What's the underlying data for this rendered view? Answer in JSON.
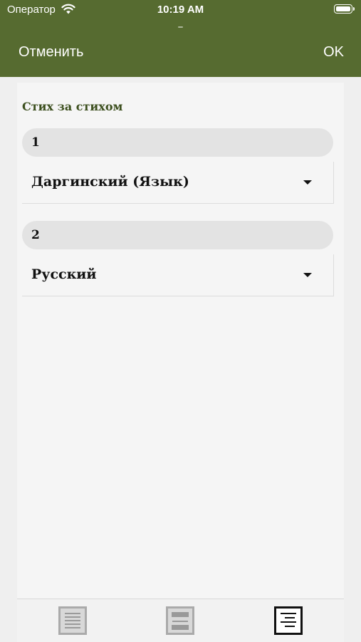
{
  "status_bar": {
    "carrier": "Оператор",
    "time": "10:19 AM",
    "wifi_icon": "wifi-icon",
    "battery_icon": "battery-icon"
  },
  "nav": {
    "cancel_label": "Отменить",
    "ok_label": "OK",
    "bar_color": "#566b30"
  },
  "content": {
    "section_title": "Стих за стихом",
    "slots": [
      {
        "number": "1",
        "language": "Даргинский (Язык)"
      },
      {
        "number": "2",
        "language": "Русский"
      }
    ]
  },
  "tabs": [
    {
      "name": "single-column-layout-icon",
      "selected": false
    },
    {
      "name": "two-pane-layout-icon",
      "selected": false
    },
    {
      "name": "verse-by-verse-layout-icon",
      "selected": true
    }
  ]
}
